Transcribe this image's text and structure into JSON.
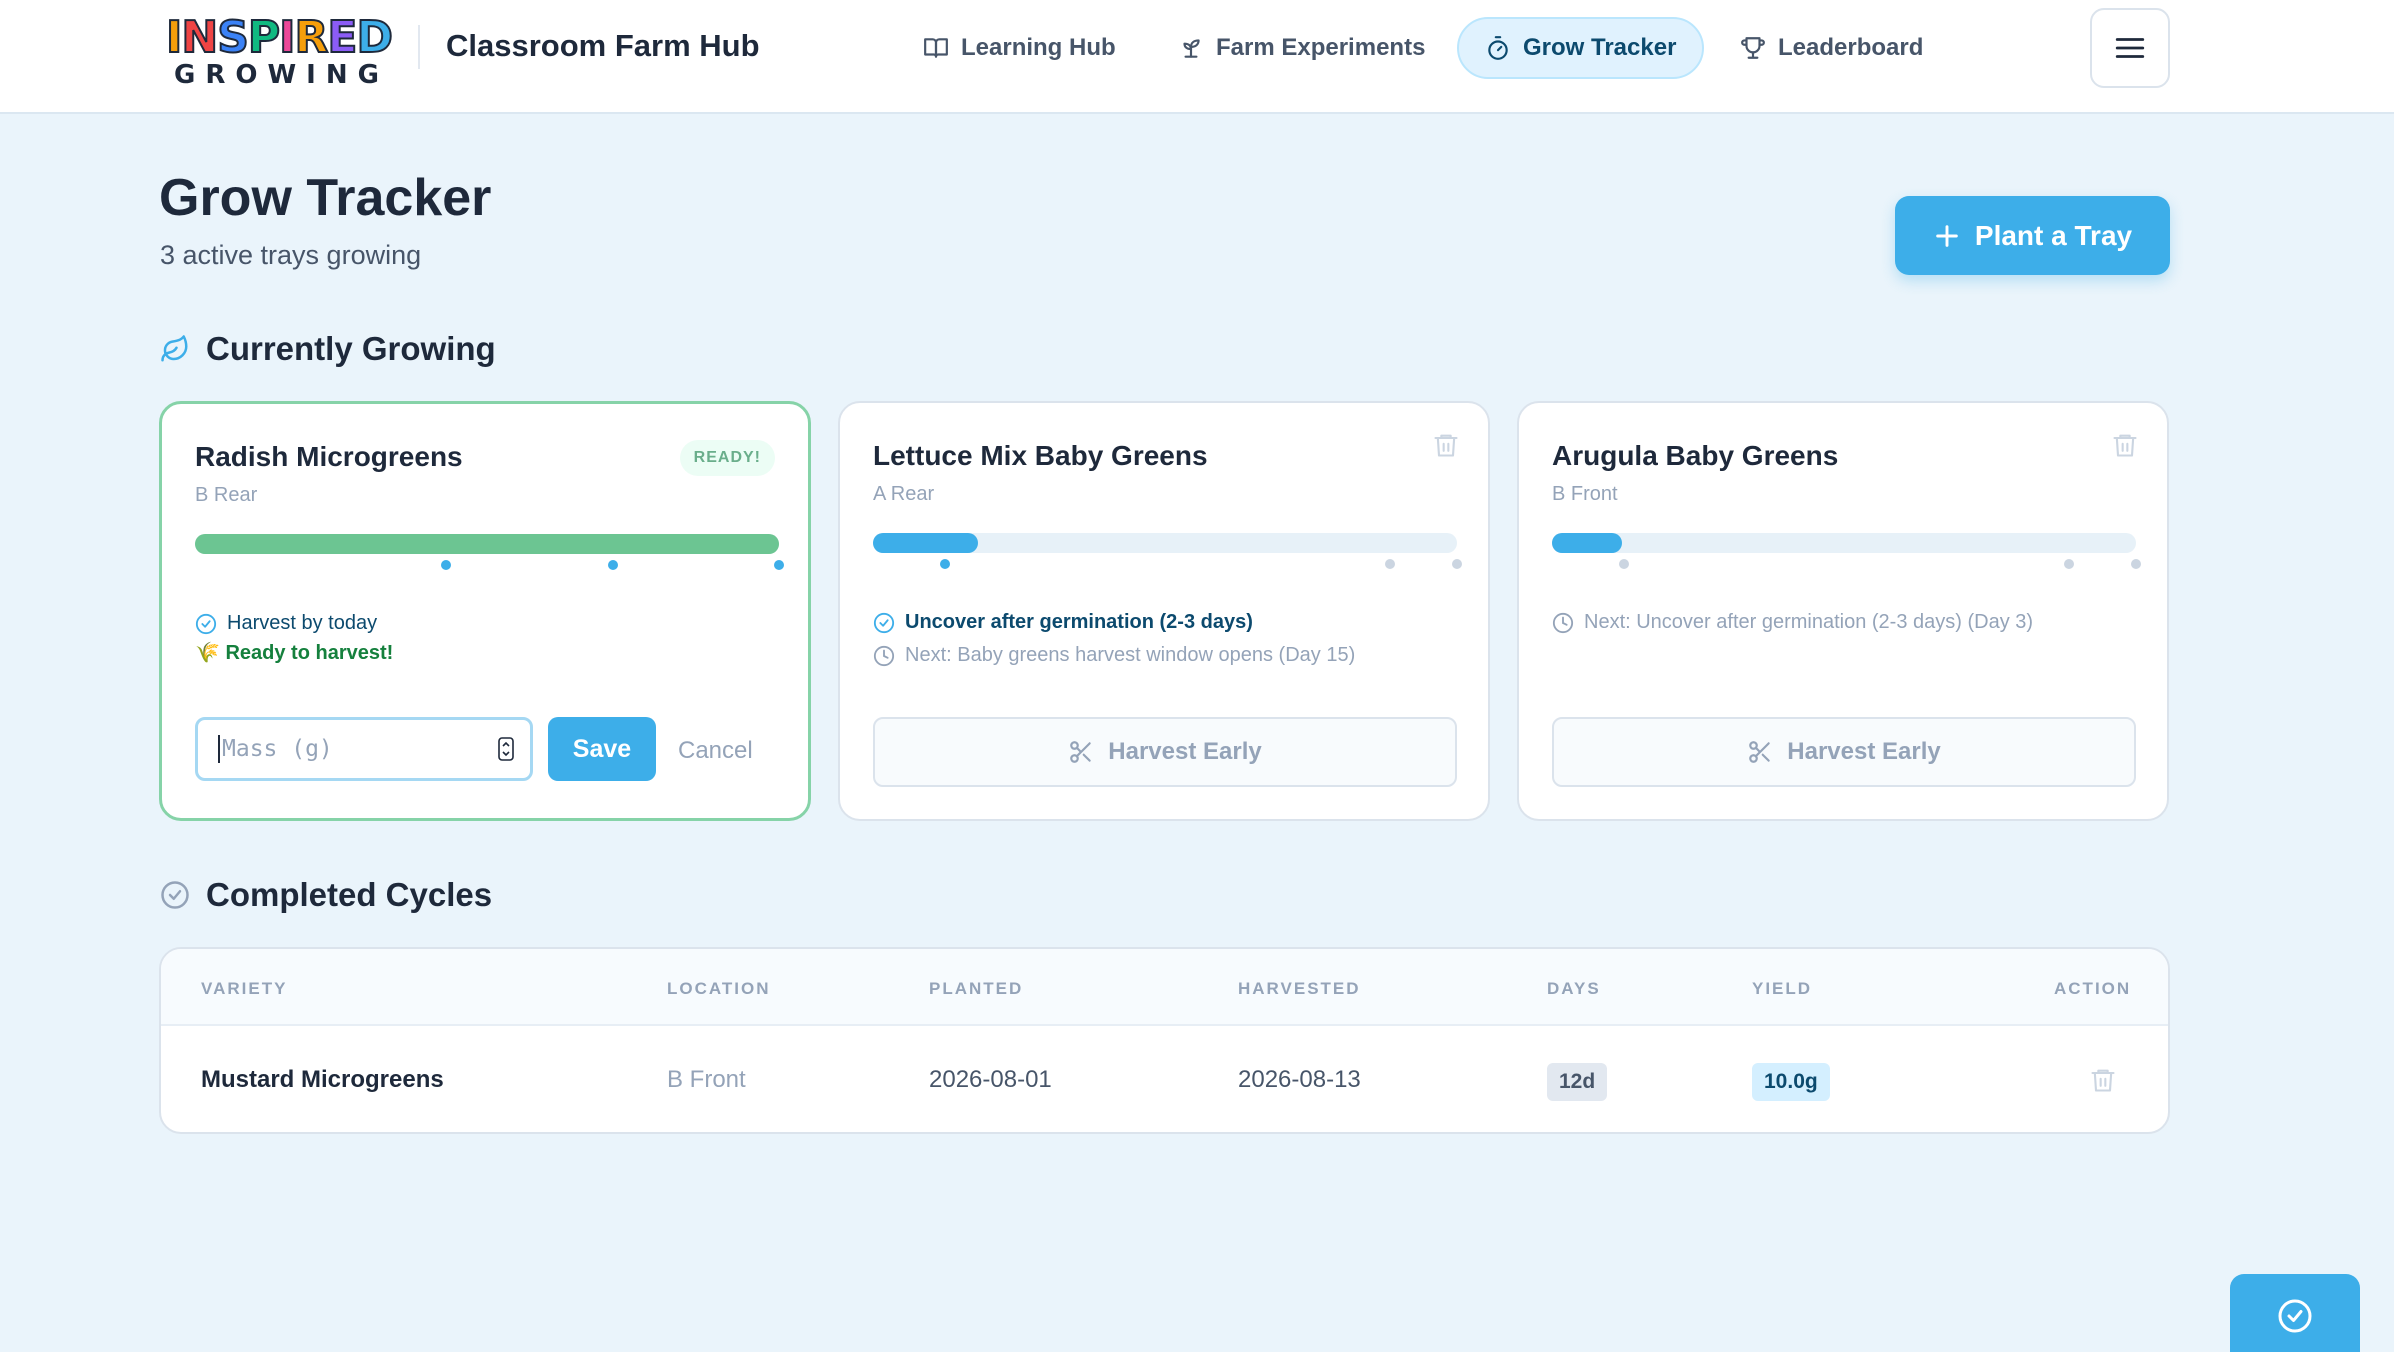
{
  "nav": {
    "logo_top": "INSPIRED",
    "logo_bottom": "GROWING",
    "app_title": "Classroom Farm Hub",
    "items": [
      {
        "label": "Learning Hub",
        "icon": "book-icon"
      },
      {
        "label": "Farm Experiments",
        "icon": "sprout-icon"
      },
      {
        "label": "Grow Tracker",
        "icon": "timer-icon",
        "active": true
      },
      {
        "label": "Leaderboard",
        "icon": "trophy-icon"
      }
    ]
  },
  "header": {
    "title": "Grow Tracker",
    "subtitle": "3 active trays growing",
    "plant_button": "Plant a Tray"
  },
  "growing": {
    "section_title": "Currently Growing",
    "cards": [
      {
        "name": "Radish Microgreens",
        "location": "B Rear",
        "badge": "READY!",
        "progress": 1.0,
        "status": "Harvest by today",
        "ready_text": "🌾 Ready to harvest!",
        "mass_placeholder": "Mass (g)",
        "save_label": "Save",
        "cancel_label": "Cancel"
      },
      {
        "name": "Lettuce Mix Baby Greens",
        "location": "A Rear",
        "progress": 0.18,
        "status": "Uncover after germination (2-3 days)",
        "next": "Next: Baby greens harvest window opens (Day 15)",
        "harvest_label": "Harvest Early"
      },
      {
        "name": "Arugula Baby Greens",
        "location": "B Front",
        "progress": 0.12,
        "next": "Next: Uncover after germination (2-3 days) (Day 3)",
        "harvest_label": "Harvest Early"
      }
    ]
  },
  "completed": {
    "section_title": "Completed Cycles",
    "columns": [
      "VARIETY",
      "LOCATION",
      "PLANTED",
      "HARVESTED",
      "DAYS",
      "YIELD",
      "ACTION"
    ],
    "rows": [
      {
        "variety": "Mustard Microgreens",
        "location": "B Front",
        "planted": "2026-08-01",
        "harvested": "2026-08-13",
        "days": "12d",
        "yield": "10.0g"
      }
    ]
  },
  "colors": {
    "accent": "#3daee9",
    "ready_green": "#6cc592",
    "background": "#eaf4fb"
  }
}
